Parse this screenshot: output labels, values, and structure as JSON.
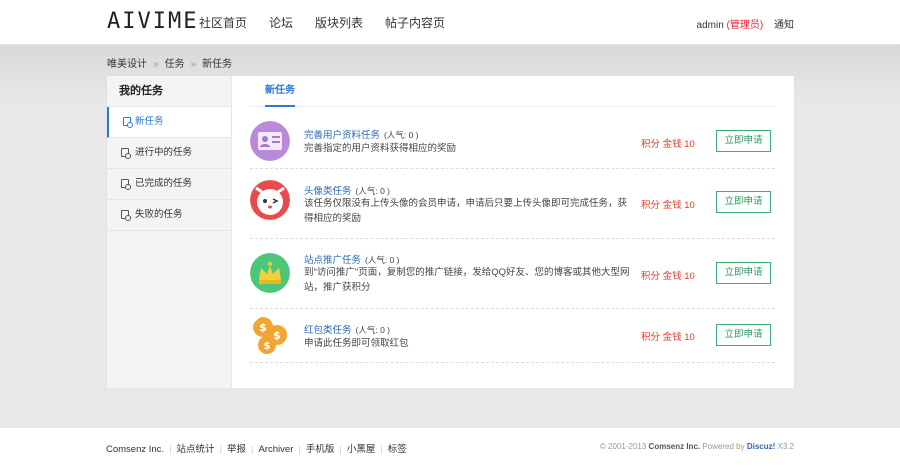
{
  "header": {
    "logo": "AIVIME",
    "nav": [
      "社区首页",
      "论坛",
      "版块列表",
      "帖子内容页"
    ],
    "user": "admin",
    "role": "(管理员)",
    "notice": "通知"
  },
  "breadcrumb": [
    "唯美设计",
    "任务",
    "新任务"
  ],
  "sidebar": {
    "title": "我的任务",
    "items": [
      "新任务",
      "进行中的任务",
      "已完成的任务",
      "失败的任务"
    ]
  },
  "tab": "新任务",
  "tasks": [
    {
      "name": "完善用户资料任务",
      "popularity": "(人气: 0 )",
      "desc": "完善指定的用户资料获得相应的奖励",
      "reward": "积分 金钱 10",
      "button": "立即申请"
    },
    {
      "name": "头像类任务",
      "popularity": "(人气: 0 )",
      "desc": "该任务仅限没有上传头像的会员申请，申请后只要上传头像即可完成任务，获得相应的奖励",
      "reward": "积分 金钱 10",
      "button": "立即申请"
    },
    {
      "name": "站点推广任务",
      "popularity": "(人气: 0 )",
      "desc": "到\"访问推广\"页面，复制您的推广链接，发给QQ好友、您的博客或其他大型网站，推广获积分",
      "reward": "积分 金钱 10",
      "button": "立即申请"
    },
    {
      "name": "红包类任务",
      "popularity": "(人气: 0 )",
      "desc": "申请此任务即可领取红包",
      "reward": "积分 金钱 10",
      "button": "立即申请"
    }
  ],
  "footer": {
    "links": [
      "Comsenz Inc.",
      "站点统计",
      "举报",
      "Archiver",
      "手机版",
      "小黑屋",
      "标签"
    ],
    "copy_prefix": "© 2001-2013",
    "copy_company": "Comsenz Inc.",
    "copy_powered": "Powered by",
    "copy_product": "Discuz!",
    "copy_version": "X3.2"
  },
  "colors": {
    "accent": "#2a7ad8",
    "reward": "#e03a2a",
    "button": "#3db072"
  }
}
